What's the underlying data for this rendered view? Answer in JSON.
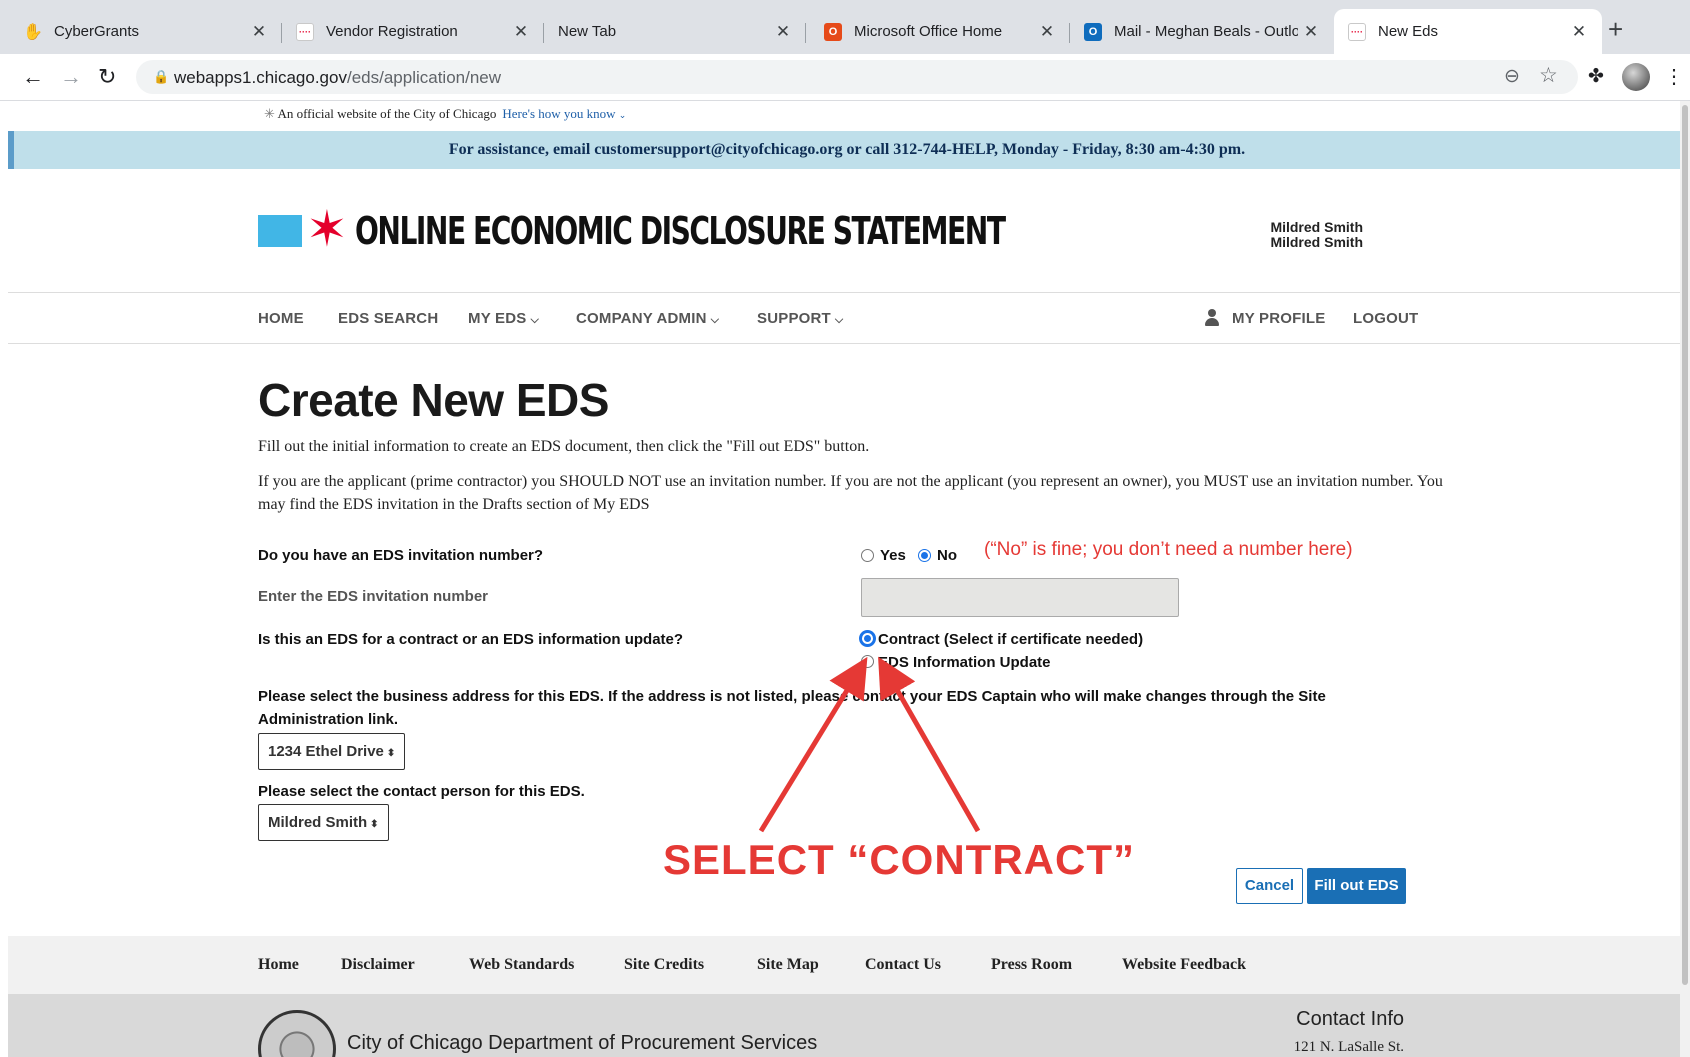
{
  "browser": {
    "tabs": [
      {
        "label": "CyberGrants",
        "favicon": "cybergrants-icon",
        "color": "#4a6fd6",
        "active": false
      },
      {
        "label": "Vendor Registration",
        "favicon": "chicago-flag-icon",
        "color": "#41b6e6",
        "active": false
      },
      {
        "label": "New Tab",
        "favicon": "",
        "color": "",
        "active": false
      },
      {
        "label": "Microsoft Office Home",
        "favicon": "office-icon",
        "color": "#e64a19",
        "active": false
      },
      {
        "label": "Mail - Meghan Beals - Outlo",
        "favicon": "outlook-icon",
        "color": "#0f6cbd",
        "active": false
      },
      {
        "label": "New Eds",
        "favicon": "chicago-flag-icon",
        "color": "#41b6e6",
        "active": true
      }
    ],
    "url_host": "webapps1.chicago.gov",
    "url_path": "/eds/application/new"
  },
  "header": {
    "official_text": "An official website of the City of Chicago",
    "how_you_know": "Here's how you know",
    "assistance_banner": "For assistance, email customersupport@cityofchicago.org or call 312-744-HELP, Monday - Friday, 8:30 am-4:30 pm.",
    "site_title": "ONLINE ECONOMIC DISCLOSURE STATEMENT",
    "user_line_1": "Mildred Smith",
    "user_line_2": "Mildred Smith"
  },
  "nav": {
    "home": "HOME",
    "eds_search": "EDS SEARCH",
    "my_eds": "MY EDS",
    "company_admin": "COMPANY ADMIN",
    "support": "SUPPORT",
    "my_profile": "MY PROFILE",
    "logout": "LOGOUT"
  },
  "form": {
    "title": "Create New EDS",
    "intro": "Fill out the initial information to create an EDS document, then click the \"Fill out EDS\" button.",
    "instructions": "If you are the applicant (prime contractor) you SHOULD NOT use an invitation number. If you are not the applicant (you represent an owner), you MUST use an invitation number. You may find the EDS invitation in the Drafts section of My EDS",
    "q_invitation": "Do you have an EDS invitation number?",
    "yes_label": "Yes",
    "no_label": "No",
    "invitation_selected": "No",
    "q_enter_number": "Enter the EDS invitation number",
    "invitation_number_value": "",
    "q_type": "Is this an EDS for a contract or an EDS information update?",
    "contract_label": "Contract (Select if certificate needed)",
    "update_label": "EDS Information Update",
    "type_selected": "Contract",
    "q_address": "Please select the business address for this EDS. If the address is not listed, please contact your EDS Captain who will make changes through the Site Administration link.",
    "address_selected": "1234 Ethel Drive",
    "q_contact": "Please select the contact person for this EDS.",
    "contact_selected": "Mildred Smith",
    "cancel_label": "Cancel",
    "fill_out_label": "Fill out EDS"
  },
  "annotations": {
    "no_note": "(“No” is fine; you don’t need a number here)",
    "select_contract": "SELECT “CONTRACT”",
    "color": "#e53935"
  },
  "footer": {
    "links": [
      "Home",
      "Disclaimer",
      "Web Standards",
      "Site Credits",
      "Site Map",
      "Contact Us",
      "Press Room",
      "Website Feedback"
    ],
    "department": "City of Chicago Department of Procurement Services",
    "contact_heading": "Contact Info",
    "contact_address": "121 N. LaSalle St."
  },
  "colors": {
    "accent_blue": "#1a6fb5",
    "flag_blue": "#41b6e6",
    "flag_red": "#e4002b",
    "banner_bg": "#bfdfea"
  }
}
